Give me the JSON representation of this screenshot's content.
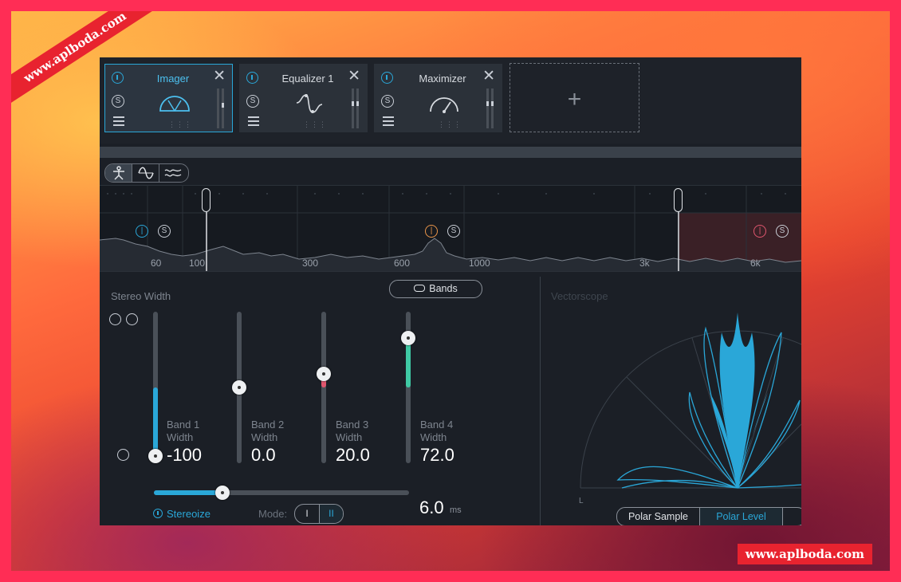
{
  "watermarks": {
    "ribbon": "www.aplboda.com",
    "bottom_right": "www.aplboda.com"
  },
  "colors": {
    "accent": "#2aa7d8",
    "band3_accent": "#e9954a",
    "band4_accent": "#e0566e",
    "band4_fill": "#3fc9a4"
  },
  "modules": [
    {
      "title": "Imager",
      "active": true,
      "icon": "imager-arc-icon"
    },
    {
      "title": "Equalizer 1",
      "active": false,
      "icon": "eq-curve-icon"
    },
    {
      "title": "Maximizer",
      "active": false,
      "icon": "gauge-icon"
    }
  ],
  "add_module": {
    "symbol": "+"
  },
  "view_toggles": [
    "imager-view-icon",
    "sine-wave-icon",
    "spectrum-wave-icon"
  ],
  "spectrum": {
    "ticks": [
      "60",
      "100",
      "300",
      "600",
      "1000",
      "3k",
      "6k"
    ],
    "band_controls": {
      "solo_label": "S"
    }
  },
  "stereo_width": {
    "label": "Stereo Width",
    "bands_button": "Bands",
    "bands": [
      {
        "name_line1": "Band 1",
        "name_line2": "Width",
        "value": "-100",
        "fraction": 0.0
      },
      {
        "name_line1": "Band 2",
        "name_line2": "Width",
        "value": "0.0",
        "fraction": 0.5
      },
      {
        "name_line1": "Band 3",
        "name_line2": "Width",
        "value": "20.0",
        "fraction": 0.6
      },
      {
        "name_line1": "Band 4",
        "name_line2": "Width",
        "value": "72.0",
        "fraction": 0.86
      }
    ],
    "stereoize": {
      "label": "Stereoize",
      "delay_value": "6.0",
      "delay_unit": "ms",
      "delay_fraction": 0.27
    },
    "mode": {
      "label": "Mode:",
      "options": [
        "I",
        "II"
      ],
      "selected": "II"
    }
  },
  "vectorscope": {
    "label": "Vectorscope",
    "axis_label": "L",
    "tabs": [
      "Polar Sample",
      "Polar Level",
      ""
    ],
    "selected_tab": "Polar Level"
  }
}
